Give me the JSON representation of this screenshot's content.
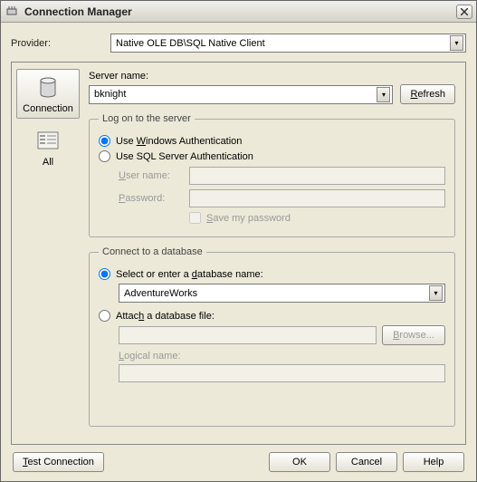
{
  "window": {
    "title": "Connection Manager"
  },
  "provider": {
    "label": "Provider:",
    "value": "Native OLE DB\\SQL Native Client"
  },
  "tabs": {
    "connection": "Connection",
    "all": "All"
  },
  "server": {
    "label": "Server name:",
    "value": "bknight",
    "refresh": "Refresh"
  },
  "logon": {
    "legend": "Log on to the server",
    "winauth_pre": "Use ",
    "winauth_u": "W",
    "winauth_post": "indows Authentication",
    "sqlauth": "Use SQL Server Authentication",
    "username_label": "User name:",
    "username_value": "",
    "password_label": "Password:",
    "password_value": "",
    "savepw_pre": "",
    "savepw_u": "S",
    "savepw_post": "ave my password"
  },
  "database": {
    "legend": "Connect to a database",
    "select_label": "Select or enter a database name:",
    "selected_db": "AdventureWorks",
    "attach_label": "Attach a database file:",
    "attach_value": "",
    "browse": "Browse...",
    "logical_label": "Logical name:",
    "logical_value": ""
  },
  "buttons": {
    "test": "Test Connection",
    "ok": "OK",
    "cancel": "Cancel",
    "help": "Help"
  }
}
